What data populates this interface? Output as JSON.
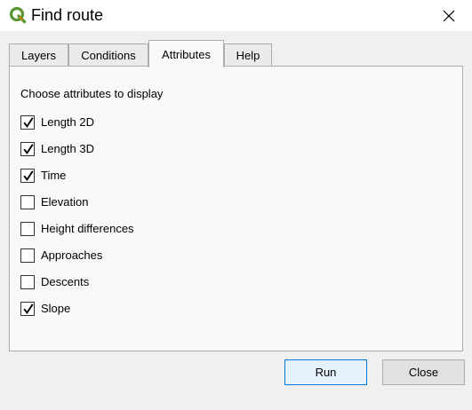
{
  "window": {
    "title": "Find route",
    "icon": "qgis-logo-icon",
    "close_icon": "close-icon"
  },
  "tabs": [
    {
      "label": "Layers",
      "active": false
    },
    {
      "label": "Conditions",
      "active": false
    },
    {
      "label": "Attributes",
      "active": true
    },
    {
      "label": "Help",
      "active": false
    }
  ],
  "panel": {
    "heading": "Choose attributes to display",
    "options": [
      {
        "label": "Length 2D",
        "checked": true
      },
      {
        "label": "Length 3D",
        "checked": true
      },
      {
        "label": "Time",
        "checked": true
      },
      {
        "label": "Elevation",
        "checked": false
      },
      {
        "label": "Height differences",
        "checked": false
      },
      {
        "label": "Approaches",
        "checked": false
      },
      {
        "label": "Descents",
        "checked": false
      },
      {
        "label": "Slope",
        "checked": true
      }
    ]
  },
  "buttons": {
    "run_label": "Run",
    "close_label": "Close"
  },
  "colors": {
    "accent": "#0078d7",
    "logo_green": "#589632",
    "logo_yellow": "#ee7913"
  }
}
